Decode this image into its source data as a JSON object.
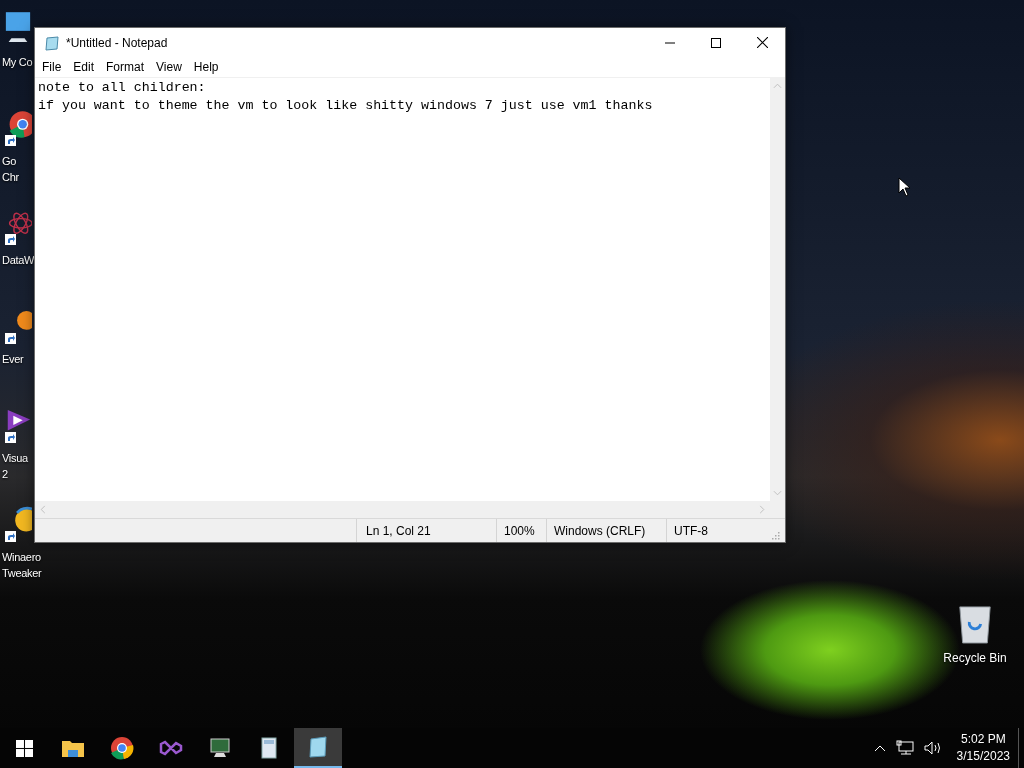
{
  "desktop_icons": [
    {
      "kind": "computer",
      "shortcut": false,
      "lines": [
        "My Co"
      ]
    },
    {
      "kind": "chrome",
      "shortcut": true,
      "lines": [
        "Go",
        "Chr"
      ]
    },
    {
      "kind": "atom",
      "shortcut": true,
      "lines": [
        "DataW"
      ]
    },
    {
      "kind": "orange",
      "shortcut": true,
      "lines": [
        "Ever"
      ]
    },
    {
      "kind": "vs",
      "shortcut": true,
      "lines": [
        "Visua",
        "2"
      ]
    },
    {
      "kind": "winaero",
      "shortcut": true,
      "lines": [
        "Winaero",
        "Tweaker"
      ]
    }
  ],
  "recycle_bin": {
    "label": "Recycle Bin"
  },
  "window": {
    "title": "*Untitled - Notepad",
    "menu": [
      "File",
      "Edit",
      "Format",
      "View",
      "Help"
    ],
    "lines": [
      "note to all children:",
      "if you want to theme the vm to look like shitty windows 7 just use vm1 thanks"
    ],
    "status_bar": [
      "Ln 1, Col 21",
      "100%",
      "Windows (CRLF)",
      "UTF-8"
    ]
  },
  "taskbar": {
    "apps": [
      {
        "kind": "explorer",
        "selected": false
      },
      {
        "kind": "chrome",
        "selected": false
      },
      {
        "kind": "vs",
        "selected": false
      },
      {
        "kind": "monitor",
        "selected": false
      },
      {
        "kind": "calculator",
        "selected": false
      },
      {
        "kind": "notepad",
        "selected": true
      }
    ],
    "time": "5:02 PM",
    "date": "3/15/2023"
  }
}
